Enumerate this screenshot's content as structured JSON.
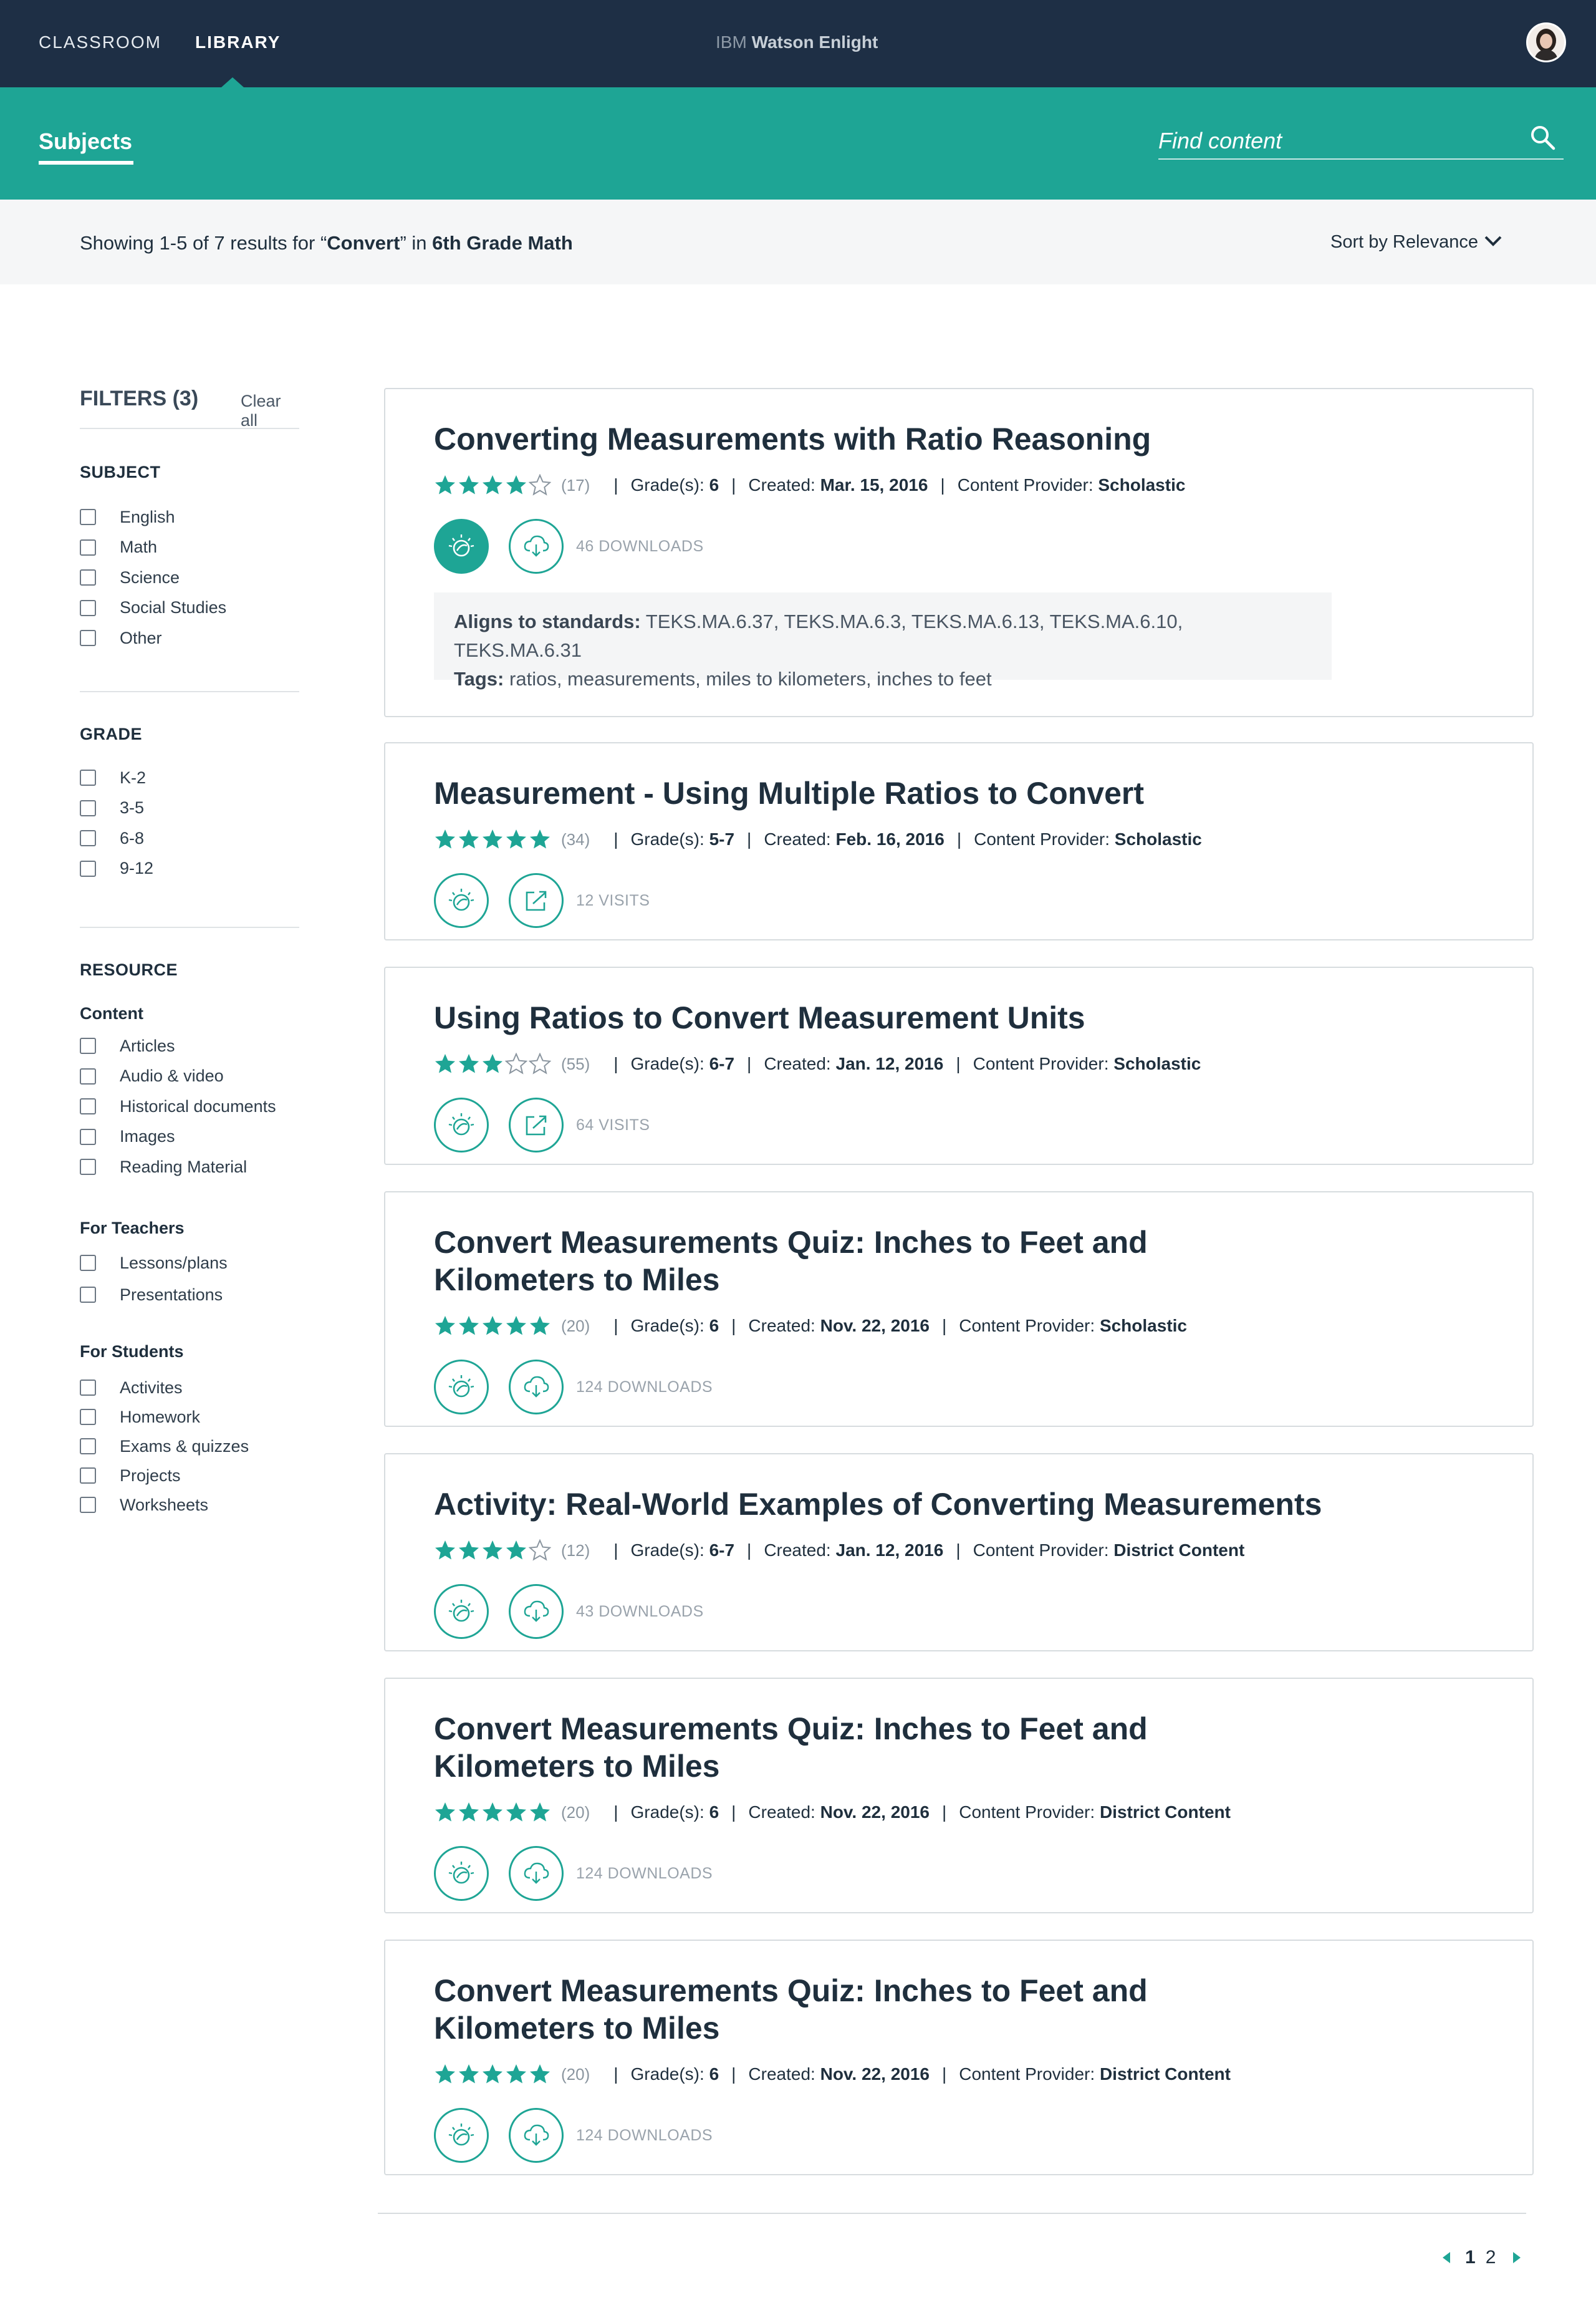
{
  "nav": {
    "links": [
      "CLASSROOM",
      "LIBRARY"
    ],
    "brand_prefix": "IBM",
    "brand_name": "Watson Enlight"
  },
  "subnav": {
    "subjects": "Subjects",
    "search_placeholder": "Find content"
  },
  "results": {
    "prefix": "Showing 1-5 of 7 results for “",
    "query": "Convert",
    "mid": "” in ",
    "scope": "6th Grade Math",
    "sort_label": "Sort by Relevance"
  },
  "filters": {
    "title": "FILTERS (3)",
    "clear_all": "Clear all",
    "subject": {
      "title": "SUBJECT",
      "items": [
        "English",
        "Math",
        "Science",
        "Social Studies",
        "Other"
      ]
    },
    "grade": {
      "title": "GRADE",
      "items": [
        "K-2",
        "3-5",
        "6-8",
        "9-12"
      ]
    },
    "resource": {
      "title": "RESOURCE",
      "content": {
        "title": "Content",
        "items": [
          "Articles",
          "Audio & video",
          "Historical documents",
          "Images",
          "Reading Material"
        ]
      },
      "teachers": {
        "title": "For Teachers",
        "items": [
          "Lessons/plans",
          "Presentations"
        ]
      },
      "students": {
        "title": "For Students",
        "items": [
          "Activites",
          "Homework",
          "Exams & quizzes",
          "Projects",
          "Worksheets"
        ]
      }
    }
  },
  "cards": [
    {
      "title": "Converting Measurements with Ratio Reasoning",
      "rating": 4,
      "count": "(17)",
      "grade_label": "Grade(s):",
      "grade": "6",
      "created_label": "Created:",
      "created": "Mar. 15, 2016",
      "provider_label": "Content Provider:",
      "provider": "Scholastic",
      "action": "download",
      "action_text": "46 DOWNLOADS",
      "standards_label": "Aligns to standards:",
      "standards": "TEKS.MA.6.37, TEKS.MA.6.3, TEKS.MA.6.13, TEKS.MA.6.10, TEKS.MA.6.31",
      "tags_label": "Tags:",
      "tags": "ratios, measurements, miles to kilometers, inches to feet"
    },
    {
      "title": "Measurement - Using Multiple Ratios to Convert",
      "rating": 5,
      "count": "(34)",
      "grade_label": "Grade(s):",
      "grade": "5-7",
      "created_label": "Created:",
      "created": "Feb. 16, 2016",
      "provider_label": "Content Provider:",
      "provider": "Scholastic",
      "action": "visit",
      "action_text": "12 VISITS"
    },
    {
      "title": "Using Ratios to Convert Measurement Units",
      "rating": 3,
      "count": "(55)",
      "grade_label": "Grade(s):",
      "grade": "6-7",
      "created_label": "Created:",
      "created": "Jan. 12, 2016",
      "provider_label": "Content Provider:",
      "provider": "Scholastic",
      "action": "visit",
      "action_text": "64 VISITS"
    },
    {
      "title": "Convert Measurements Quiz: Inches to Feet and Kilometers to Miles",
      "rating": 5,
      "count": "(20)",
      "grade_label": "Grade(s):",
      "grade": "6",
      "created_label": "Created:",
      "created": "Nov. 22, 2016",
      "provider_label": "Content Provider:",
      "provider": "Scholastic",
      "action": "download",
      "action_text": "124 DOWNLOADS"
    },
    {
      "title": "Activity: Real-World Examples of Converting Measurements",
      "rating": 4,
      "count": "(12)",
      "grade_label": "Grade(s):",
      "grade": "6-7",
      "created_label": "Created:",
      "created": "Jan. 12, 2016",
      "provider_label": "Content Provider:",
      "provider": "District Content",
      "action": "download",
      "action_text": "43 DOWNLOADS"
    },
    {
      "title": "Convert Measurements Quiz: Inches to Feet and Kilometers to Miles",
      "rating": 5,
      "count": "(20)",
      "grade_label": "Grade(s):",
      "grade": "6",
      "created_label": "Created:",
      "created": "Nov. 22, 2016",
      "provider_label": "Content Provider:",
      "provider": "District Content",
      "action": "download",
      "action_text": "124 DOWNLOADS"
    },
    {
      "title": "Convert Measurements Quiz: Inches to Feet and Kilometers to Miles",
      "rating": 5,
      "count": "(20)",
      "grade_label": "Grade(s):",
      "grade": "6",
      "created_label": "Created:",
      "created": "Nov. 22, 2016",
      "provider_label": "Content Provider:",
      "provider": "District Content",
      "action": "download",
      "action_text": "124 DOWNLOADS"
    }
  ],
  "pagination": {
    "pages": [
      "1",
      "2"
    ],
    "current": "1"
  },
  "colors": {
    "nav": "#1e2f45",
    "accent": "#1ea595",
    "text": "#1f2f3d"
  }
}
